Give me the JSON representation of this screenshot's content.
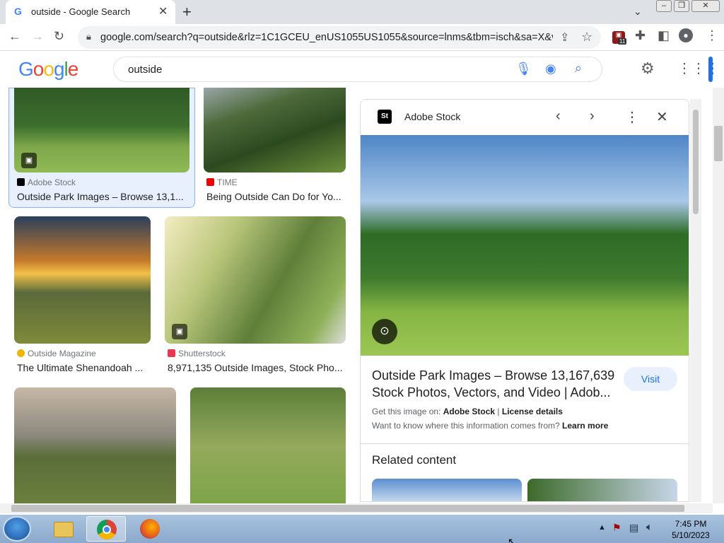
{
  "browser": {
    "tab_title": "outside - Google Search",
    "url": "google.com/search?q=outside&rlz=1C1GCEU_enUS1055US1055&source=lnms&tbm=isch&sa=X&ve...",
    "extension_badge": "11"
  },
  "google": {
    "logo": "Google",
    "query": "outside"
  },
  "results": [
    {
      "source": "Adobe Stock",
      "caption": "Outside Park Images – Browse 13,1..."
    },
    {
      "source": "TIME",
      "caption": "Being Outside Can Do for Yo..."
    },
    {
      "source": "Outside Magazine",
      "caption": "The Ultimate Shenandoah ..."
    },
    {
      "source": "Shutterstock",
      "caption": "8,971,135 Outside Images, Stock Pho..."
    },
    {
      "source": "",
      "caption": ""
    },
    {
      "source": "",
      "caption": ""
    }
  ],
  "preview": {
    "source": "Adobe Stock",
    "source_logo": "St",
    "title": "Outside Park Images – Browse 13,167,639 Stock Photos, Vectors, and Video | Adob...",
    "visit_label": "Visit",
    "get_image_prefix": "Get this image on:",
    "get_image_source": "Adobe Stock",
    "separator": "|",
    "license": "License details",
    "where_from": "Want to know where this information comes from?",
    "learn_more": "Learn more",
    "related_heading": "Related content"
  },
  "taskbar": {
    "time": "7:45 PM",
    "date": "5/10/2023"
  }
}
